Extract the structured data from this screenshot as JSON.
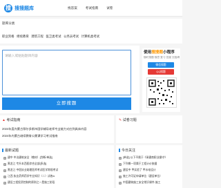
{
  "header": {
    "logo_text": "搜搜题库",
    "nav": [
      "找答案",
      "考试指南",
      "试卷"
    ]
  },
  "categories": {
    "title": "题库分类",
    "items": [
      "职业资格",
      "继续教育",
      "建筑工程",
      "医卫类考试",
      "公务员考试",
      "计算机类考试"
    ]
  },
  "search": {
    "placeholder": "请输入或粘贴题目内容",
    "button_label": "立即搜题"
  },
  "app_card": {
    "title_prefix": "使用",
    "title_highlight": "搜搜题",
    "title_suffix": "小程序",
    "subtitle": "随时搜题 随意 复习 答疑 无阻碍",
    "button_wechat": "微信搜题",
    "button_qq": "QQ搜题",
    "colors": {
      "wechat": "#1e88e5",
      "qq": "#e53935"
    }
  },
  "exam_guide": {
    "title": "考试指南",
    "items": [
      "2024年度内蒙古鄂尔多斯市国学辅导老师专业能力对应到具体内容",
      "2024年内蒙古继续教育公需课学习考试指南"
    ]
  },
  "popular": {
    "title": "试卷习题"
  },
  "latest": {
    "title": "最新试题",
    "items": [
      "建中 中冶建筑安全（教材）[判断/单选]",
      "黑龙江 专升本西医综合全部[多选]",
      "黑龙江 中医执业助理医师考试医学常规考试",
      "江西 执业药师药学专业知识（二）试卷A",
      "建设工程投资控制的原则之一是施工阶段"
    ]
  },
  "hot": {
    "title": "今日关注",
    "items": [
      "[单选] 以下不属于《承建商职业操守》",
      "下列哪一项属于工程计价依据",
      "建设中 甲实验了 甲水电设计",
      "施工许可证申请单位（建设单位）",
      "中国建筑施工安全常识课件-施工"
    ]
  }
}
